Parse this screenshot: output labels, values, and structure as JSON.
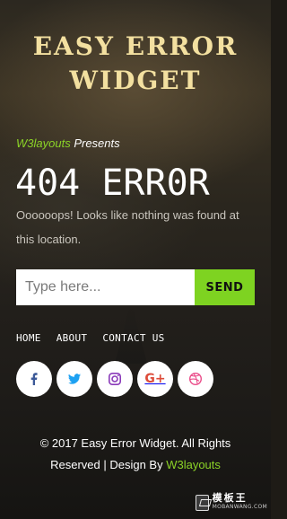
{
  "header": {
    "title_line1": "EASY ERROR",
    "title_line2": "WIDGET"
  },
  "presents": {
    "brand": "W3layouts",
    "rest": " Presents"
  },
  "error": {
    "code_title": "404 ERR0R",
    "message": "Oooooops! Looks like nothing was found at this location."
  },
  "search": {
    "placeholder": "Type here...",
    "value": "",
    "button_label": "SEND"
  },
  "nav": {
    "items": [
      "HOME",
      "ABOUT",
      "CONTACT US"
    ]
  },
  "social": {
    "icons": [
      {
        "name": "facebook-icon",
        "color": "#3b5998"
      },
      {
        "name": "twitter-icon",
        "color": "#1da1f2"
      },
      {
        "name": "instagram-icon",
        "color": "#8a3ab9"
      },
      {
        "name": "google-plus-icon",
        "color": "#dd4b39"
      },
      {
        "name": "dribbble-icon",
        "color": "#ea4c89"
      }
    ],
    "google_plus_glyph": "G+"
  },
  "footer": {
    "line1": "© 2017 Easy Error Widget. All Rights",
    "line2_prefix": "Reserved | Design By ",
    "line2_link": "W3layouts"
  },
  "watermark": {
    "main": "模板王",
    "sub": "MOBANWANG.COM"
  },
  "colors": {
    "accent": "#7ed321",
    "title": "#f3e0a0"
  }
}
